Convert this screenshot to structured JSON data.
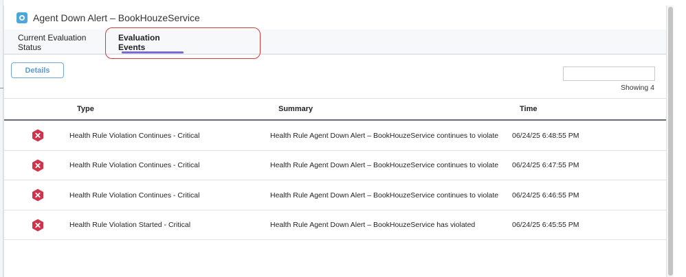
{
  "window": {
    "title": "Agent Down Alert – BookHouzeService",
    "icon": "health-rule-icon"
  },
  "tabs": [
    {
      "label": "Current Evaluation Status",
      "active": false
    },
    {
      "label": "Evaluation Events",
      "active": true
    }
  ],
  "colors": {
    "accent": "#7b68d9",
    "critical": "#d1344a",
    "button_border": "#6fa5d3",
    "annotation": "#d33b3b"
  },
  "toolbar": {
    "details_label": "Details"
  },
  "search": {
    "value": "",
    "placeholder": ""
  },
  "showing": "Showing 4",
  "table": {
    "columns": [
      "Type",
      "Summary",
      "Time"
    ],
    "rows": [
      {
        "status_icon": "critical-icon",
        "type": "Health Rule Violation Continues - Critical",
        "summary": "Health Rule Agent Down Alert – BookHouzeService continues to violate",
        "time": "06/24/25 6:48:55 PM"
      },
      {
        "status_icon": "critical-icon",
        "type": "Health Rule Violation Continues - Critical",
        "summary": "Health Rule Agent Down Alert – BookHouzeService continues to violate",
        "time": "06/24/25 6:47:55 PM"
      },
      {
        "status_icon": "critical-icon",
        "type": "Health Rule Violation Continues - Critical",
        "summary": "Health Rule Agent Down Alert – BookHouzeService continues to violate",
        "time": "06/24/25 6:46:55 PM"
      },
      {
        "status_icon": "critical-icon",
        "type": "Health Rule Violation Started - Critical",
        "summary": "Health Rule Agent Down Alert – BookHouzeService has violated",
        "time": "06/24/25 6:45:55 PM"
      }
    ]
  }
}
